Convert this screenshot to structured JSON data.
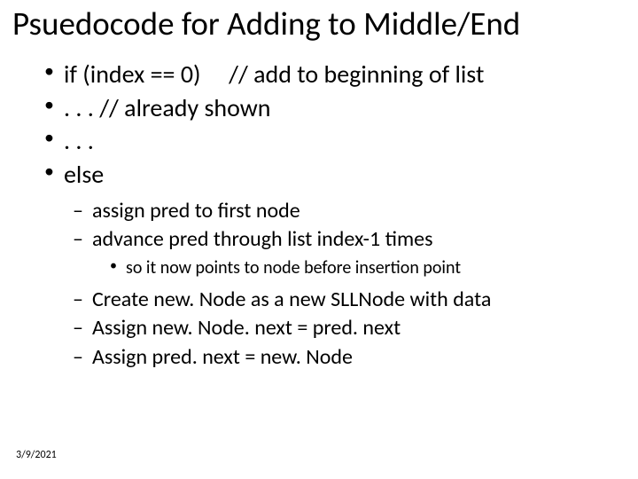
{
  "title": "Psuedocode for Adding to Middle/End",
  "l1": [
    {
      "text_a": "if (index == 0)",
      "text_b": "// add to beginning of list"
    },
    {
      "text_a": ". . .   // already shown"
    },
    {
      "text_a": ". . ."
    },
    {
      "text_a": "else"
    }
  ],
  "l2a": [
    {
      "text": "assign pred to first node"
    },
    {
      "text": "advance pred through list  index-1 times"
    }
  ],
  "l3": [
    {
      "text": "so it now points to node before insertion point"
    }
  ],
  "l2b": [
    {
      "text": "Create  new. Node as a new SLLNode with data"
    },
    {
      "text": "Assign new. Node. next =  pred. next"
    },
    {
      "text": "Assign pred. next  = new. Node"
    }
  ],
  "footer_date": "3/9/2021"
}
